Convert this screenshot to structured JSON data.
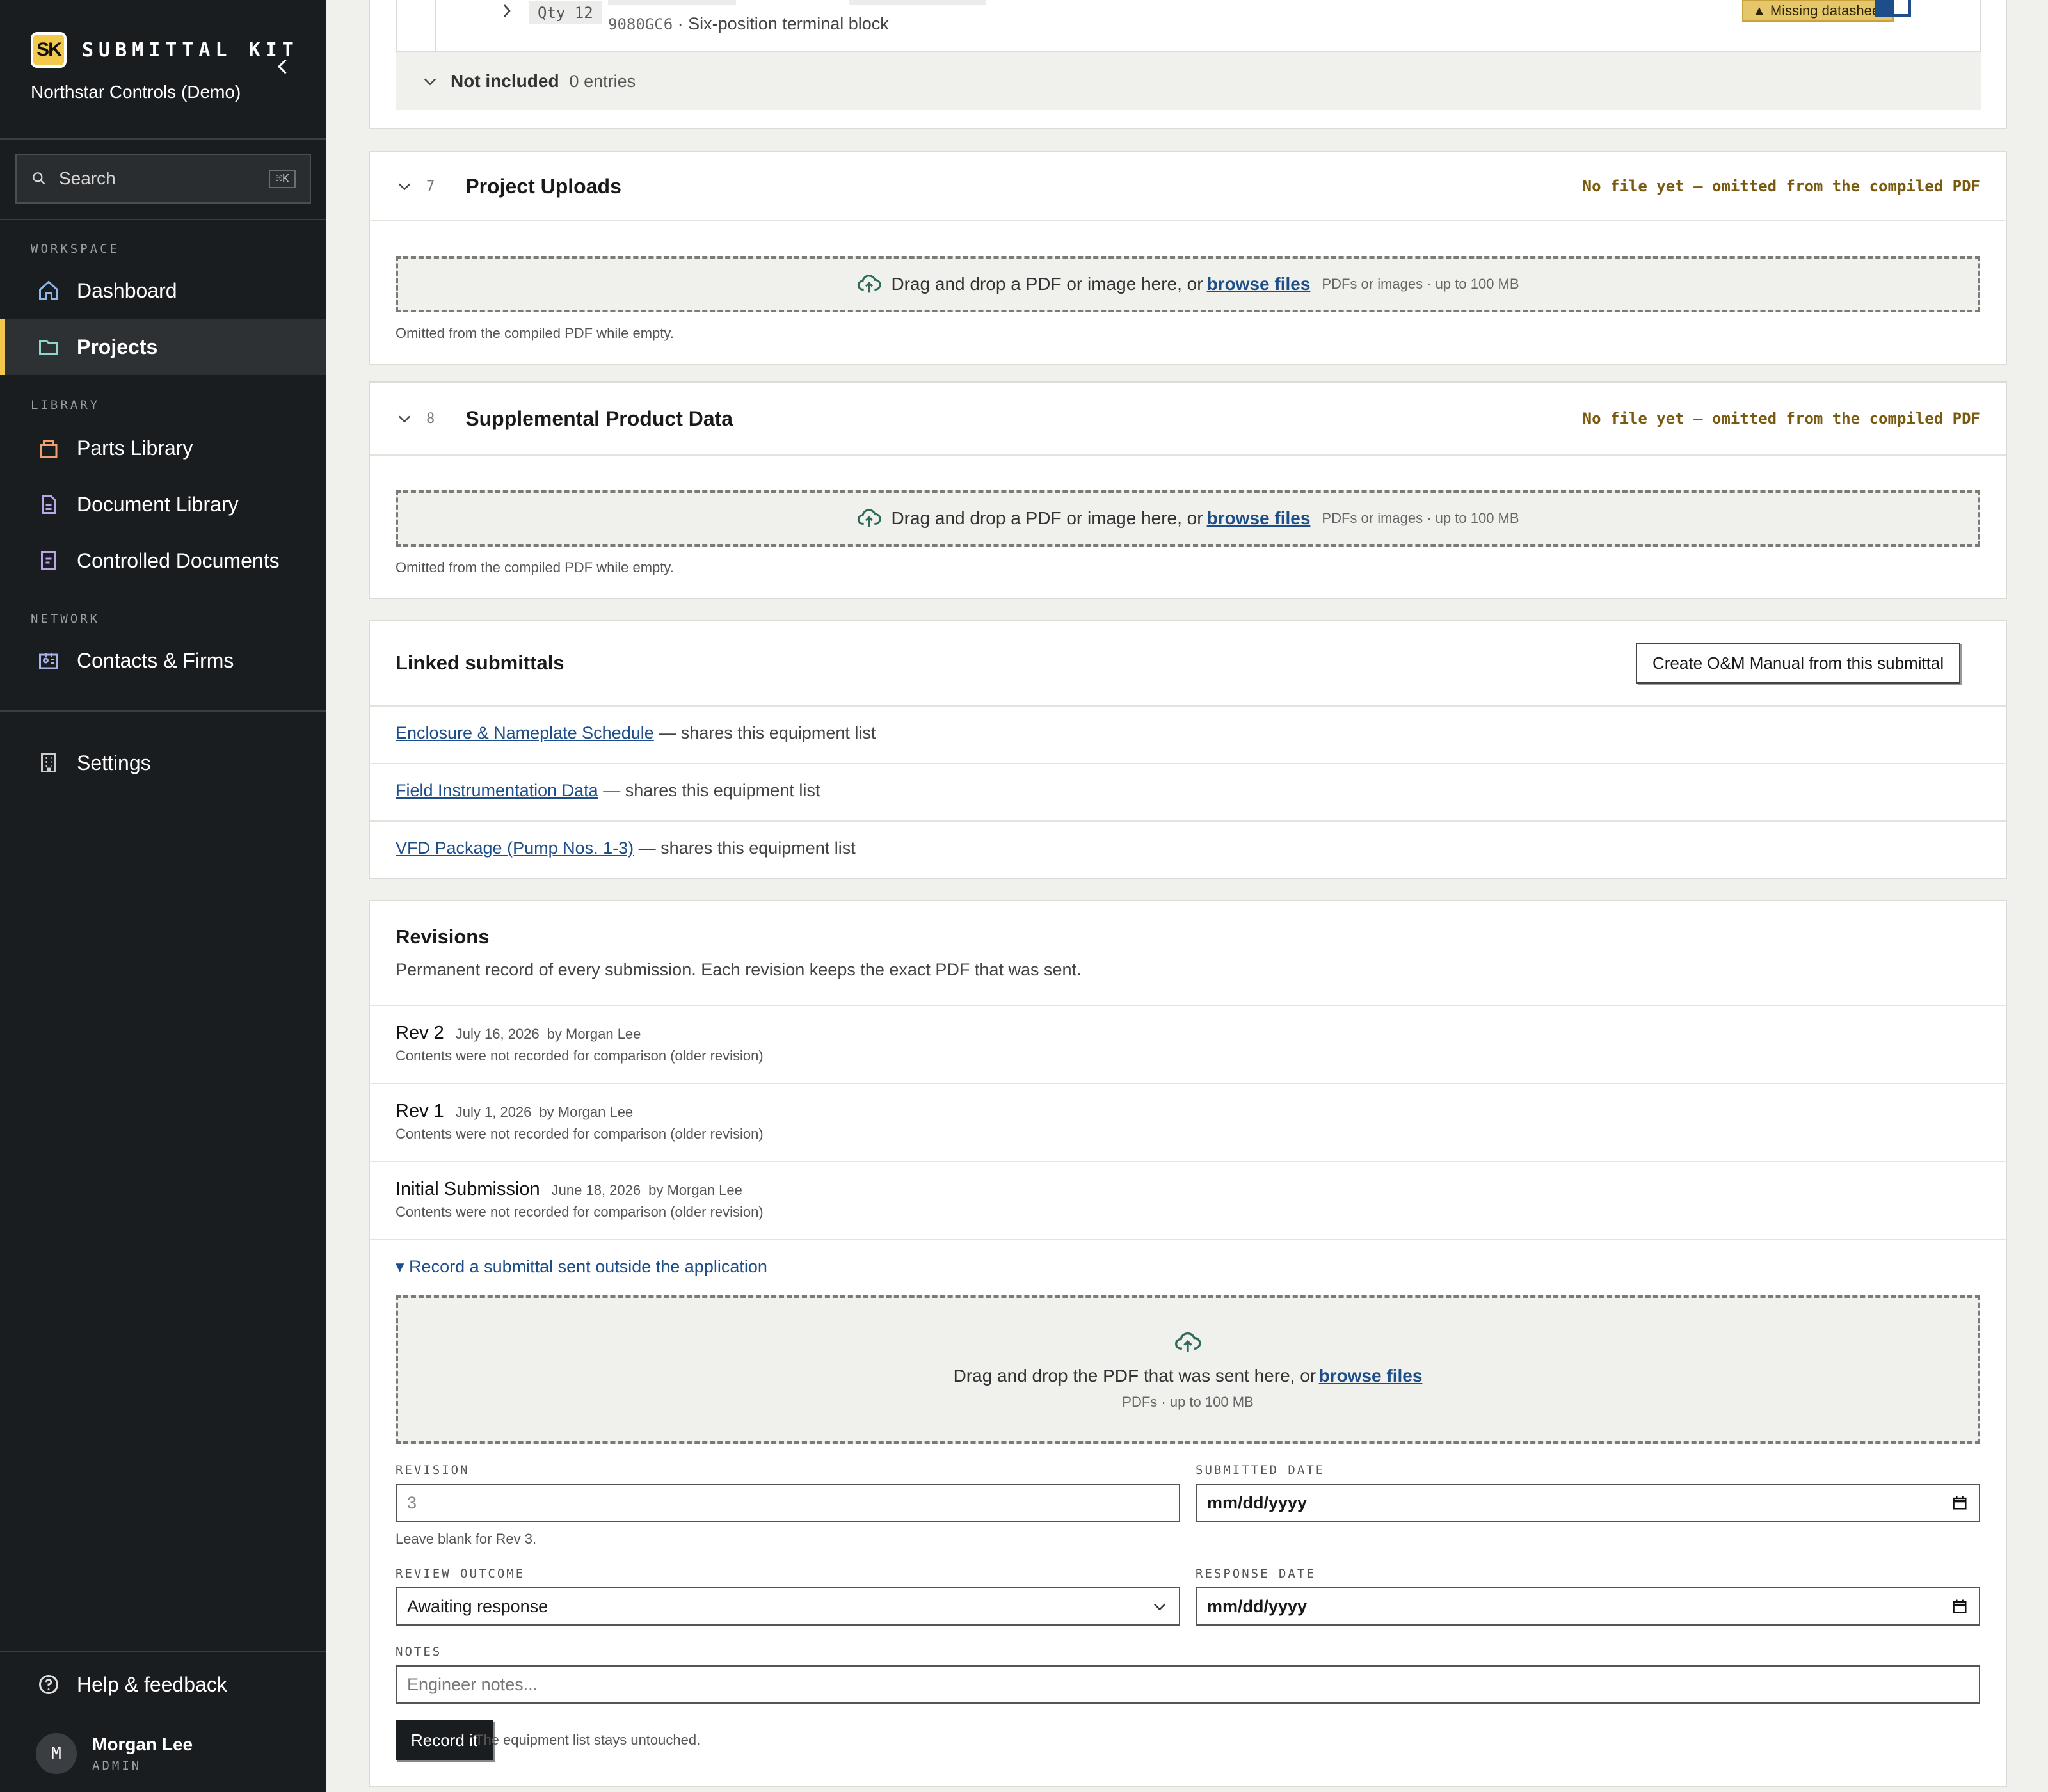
{
  "app": {
    "logo_text": "SK",
    "name": "SUBMITTAL KIT",
    "org": "Northstar Controls (Demo)"
  },
  "search": {
    "placeholder": "Search",
    "shortcut": "⌘K"
  },
  "nav": {
    "workspace_label": "WORKSPACE",
    "dashboard": "Dashboard",
    "projects": "Projects",
    "library_label": "LIBRARY",
    "parts_library": "Parts Library",
    "document_library": "Document Library",
    "controlled_documents": "Controlled Documents",
    "network_label": "NETWORK",
    "contacts_firms": "Contacts & Firms",
    "settings": "Settings",
    "help": "Help & feedback"
  },
  "user": {
    "initial": "M",
    "name": "Morgan Lee",
    "role": "ADMIN"
  },
  "partial_item": {
    "qty": "Qty 12",
    "part_number": "9080GC6",
    "description": "· Six-position terminal block",
    "badge": "▲ Missing datasheet"
  },
  "not_included": {
    "label": "Not included",
    "count": "0 entries"
  },
  "sections": [
    {
      "number": "7",
      "title": "Project Uploads",
      "status": "No file yet — omitted from the compiled PDF",
      "drop_text": "Drag and drop a PDF or image here, or",
      "browse": "browse files",
      "drop_meta": "PDFs or images · up to 100 MB",
      "help": "Omitted from the compiled PDF while empty."
    },
    {
      "number": "8",
      "title": "Supplemental Product Data",
      "status": "No file yet — omitted from the compiled PDF",
      "drop_text": "Drag and drop a PDF or image here, or",
      "browse": "browse files",
      "drop_meta": "PDFs or images · up to 100 MB",
      "help": "Omitted from the compiled PDF while empty."
    }
  ],
  "linked": {
    "title": "Linked submittals",
    "create_button": "Create O&M Manual from this submittal",
    "items": [
      {
        "name": "Enclosure & Nameplate Schedule",
        "note": "— shares this equipment list"
      },
      {
        "name": "Field Instrumentation Data",
        "note": "— shares this equipment list"
      },
      {
        "name": "VFD Package (Pump Nos. 1-3)",
        "note": "— shares this equipment list"
      }
    ]
  },
  "revisions": {
    "title": "Revisions",
    "subtitle": "Permanent record of every submission. Each revision keeps the exact PDF that was sent.",
    "items": [
      {
        "name": "Rev 2",
        "date": "July 16, 2026",
        "by": "by Morgan Lee",
        "note": "Contents were not recorded for comparison (older revision)"
      },
      {
        "name": "Rev 1",
        "date": "July 1, 2026",
        "by": "by Morgan Lee",
        "note": "Contents were not recorded for comparison (older revision)"
      },
      {
        "name": "Initial Submission",
        "date": "June 18, 2026",
        "by": "by Morgan Lee",
        "note": "Contents were not recorded for comparison (older revision)"
      }
    ],
    "record_toggle": "▾ Record a submittal sent outside the application",
    "drop_text": "Drag and drop the PDF that was sent here, or",
    "browse": "browse files",
    "drop_meta": "PDFs · up to 100 MB",
    "form": {
      "revision_label": "REVISION",
      "revision_placeholder": "3",
      "revision_help": "Leave blank for Rev 3.",
      "submitted_label": "SUBMITTED DATE",
      "submitted_value": "mm/dd/yyyy",
      "outcome_label": "REVIEW OUTCOME",
      "outcome_value": "Awaiting response",
      "response_label": "RESPONSE DATE",
      "response_value": "mm/dd/yyyy",
      "notes_label": "NOTES",
      "notes_placeholder": "Engineer notes...",
      "submit": "Record it",
      "submit_note": "The equipment list stays untouched."
    }
  }
}
